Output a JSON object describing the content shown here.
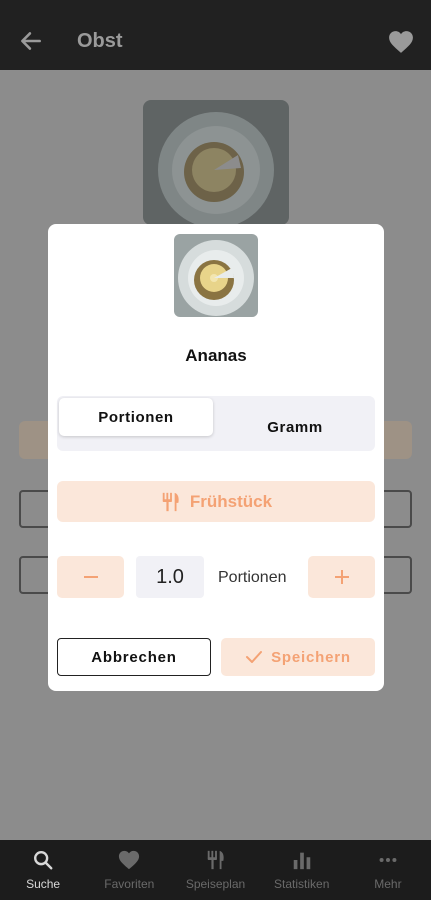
{
  "appbar": {
    "title": "Obst"
  },
  "dialog": {
    "title": "Ananas",
    "segments": {
      "portions": "Portionen",
      "grams": "Gramm"
    },
    "meal": "Frühstück",
    "quantity": "1.0",
    "unit": "Portionen",
    "cancel": "Abbrechen",
    "save": "Speichern"
  },
  "nav": [
    {
      "label": "Suche",
      "icon": "search-icon"
    },
    {
      "label": "Favoriten",
      "icon": "heart-icon"
    },
    {
      "label": "Speiseplan",
      "icon": "cutlery-icon"
    },
    {
      "label": "Statistiken",
      "icon": "bar-chart-icon"
    },
    {
      "label": "Mehr",
      "icon": "more-icon"
    }
  ],
  "colors": {
    "accent": "#f4a274",
    "accent_bg": "#fbe7da",
    "appbar": "#212121"
  }
}
